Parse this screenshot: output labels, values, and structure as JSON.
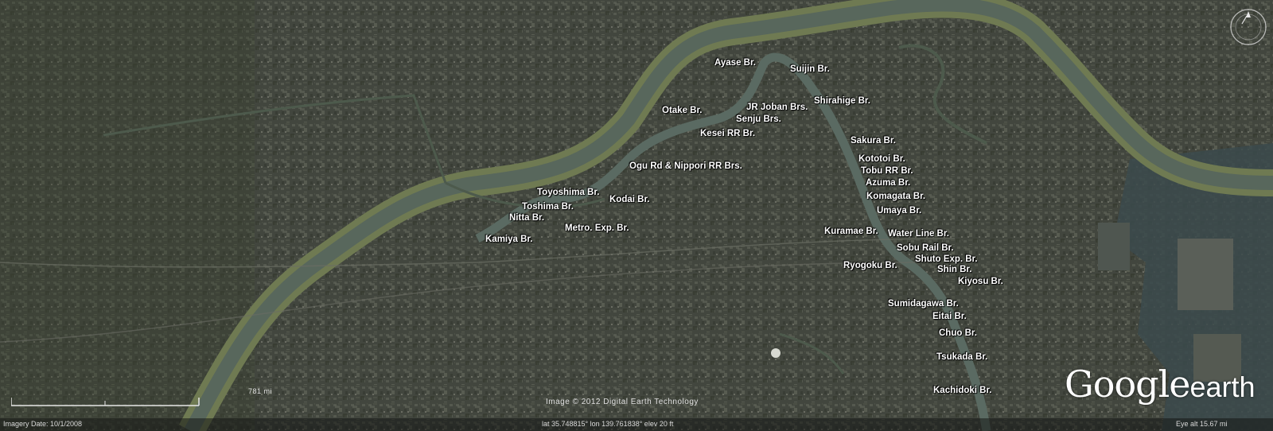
{
  "map": {
    "labels": [
      {
        "id": "ayase",
        "text": "Ayase Br."
      },
      {
        "id": "suijin",
        "text": "Suijin Br."
      },
      {
        "id": "otake",
        "text": "Otake Br."
      },
      {
        "id": "jr-joban",
        "text": "JR Joban Brs."
      },
      {
        "id": "shirahige",
        "text": "Shirahige Br."
      },
      {
        "id": "senju",
        "text": "Senju Brs."
      },
      {
        "id": "kesei-rr",
        "text": "Kesei RR Br."
      },
      {
        "id": "sakura",
        "text": "Sakura Br."
      },
      {
        "id": "kototoi",
        "text": "Kototoi Br."
      },
      {
        "id": "ogu-nippori",
        "text": "Ogu Rd & Nippori RR Brs."
      },
      {
        "id": "tobu-rr",
        "text": "Tobu RR Br."
      },
      {
        "id": "azuma",
        "text": "Azuma Br."
      },
      {
        "id": "toyoshima",
        "text": "Toyoshima Br."
      },
      {
        "id": "komagata",
        "text": "Komagata Br."
      },
      {
        "id": "kodai",
        "text": "Kodai Br."
      },
      {
        "id": "toshima",
        "text": "Toshima Br."
      },
      {
        "id": "umaya",
        "text": "Umaya Br."
      },
      {
        "id": "nitta",
        "text": "Nitta Br."
      },
      {
        "id": "metro-exp",
        "text": "Metro. Exp. Br."
      },
      {
        "id": "kuramae",
        "text": "Kuramae Br."
      },
      {
        "id": "water-line",
        "text": "Water Line Br."
      },
      {
        "id": "kamiya",
        "text": "Kamiya Br."
      },
      {
        "id": "sobu-rail",
        "text": "Sobu Rail Br."
      },
      {
        "id": "shuto-exp",
        "text": "Shuto Exp. Br."
      },
      {
        "id": "ryogoku",
        "text": "Ryogoku Br."
      },
      {
        "id": "shin",
        "text": "Shin Br."
      },
      {
        "id": "kiyosu",
        "text": "Kiyosu Br."
      },
      {
        "id": "sumidagawa",
        "text": "Sumidagawa Br."
      },
      {
        "id": "eitai",
        "text": "Eitai Br."
      },
      {
        "id": "chuo",
        "text": "Chuo Br."
      },
      {
        "id": "tsukada",
        "text": "Tsukada Br."
      },
      {
        "id": "kachidoki",
        "text": "Kachidoki Br."
      }
    ]
  },
  "scale_bar": {
    "label": "781 mi"
  },
  "status_bar": {
    "imagery_date": "Imagery Date: 10/1/2008",
    "coords": "lat  35.748815°  lon  139.761838°  elev   20 ft",
    "eye_alt": "Eye alt   15.67 mi"
  },
  "credit": "Image © 2012 Digital Earth Technology",
  "logo": {
    "google": "Google",
    "earth": "earth"
  },
  "colors": {
    "river": "#5c6b5a",
    "riverbank": "#6f7a52",
    "urban": "#3e423a",
    "label": "#ffffff"
  }
}
